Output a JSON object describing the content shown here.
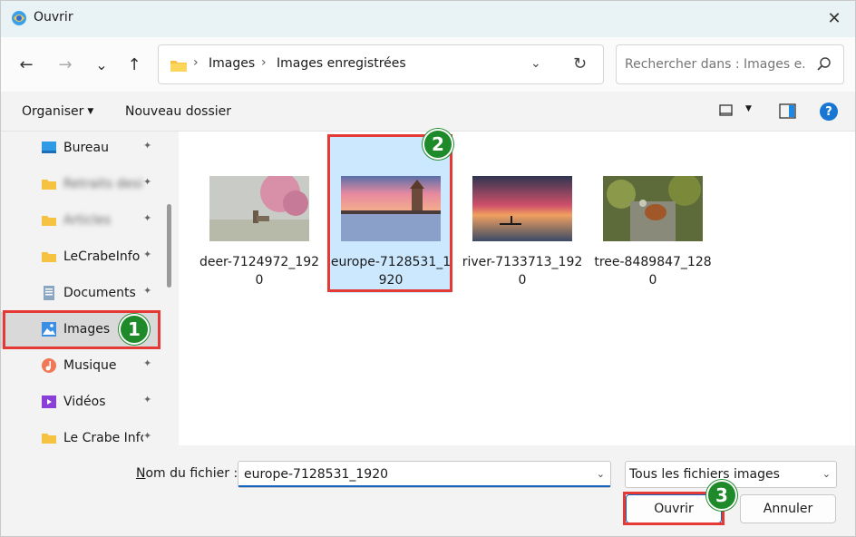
{
  "window": {
    "title": "Ouvrir",
    "close_glyph": "✕",
    "app_icon": "file-explorer-icon"
  },
  "nav": {
    "back_glyph": "←",
    "forward_glyph": "→",
    "recent_glyph": "⌄",
    "up_glyph": "↑",
    "breadcrumb": [
      "Images",
      "Images enregistrées"
    ],
    "separator": "›",
    "refresh_glyph": "↻",
    "dropdown_glyph": "⌄"
  },
  "search": {
    "placeholder": "Rechercher dans : Images e..."
  },
  "toolbar": {
    "organize_label": "Organiser",
    "new_folder_label": "Nouveau dossier",
    "caret": "▼",
    "help_label": "?"
  },
  "sidebar": {
    "items": [
      {
        "label": "Bureau",
        "icon": "desktop-icon",
        "pinned": true,
        "blurred": false
      },
      {
        "label": "Retraits design",
        "icon": "folder-icon",
        "pinned": true,
        "blurred": true
      },
      {
        "label": "Articles",
        "icon": "folder-icon",
        "pinned": true,
        "blurred": true
      },
      {
        "label": "LeCrabeInfo Images",
        "icon": "folder-icon",
        "pinned": true,
        "blurred": false
      },
      {
        "label": "Documents",
        "icon": "documents-icon",
        "pinned": true,
        "blurred": false
      },
      {
        "label": "Images",
        "icon": "pictures-icon",
        "pinned": true,
        "blurred": false,
        "selected": true
      },
      {
        "label": "Musique",
        "icon": "music-icon",
        "pinned": true,
        "blurred": false
      },
      {
        "label": "Vidéos",
        "icon": "videos-icon",
        "pinned": true,
        "blurred": false
      },
      {
        "label": "Le Crabe Info",
        "icon": "folder-icon",
        "pinned": true,
        "blurred": false
      }
    ],
    "pin_glyph": "📌"
  },
  "files": [
    {
      "name": "deer-7124972_1920",
      "kind": "deer"
    },
    {
      "name": "europe-7128531_1920",
      "kind": "europe",
      "selected": true
    },
    {
      "name": "river-7133713_1920",
      "kind": "river"
    },
    {
      "name": "tree-8489847_1280",
      "kind": "tree"
    }
  ],
  "footer": {
    "filename_label_prefix": "N",
    "filename_label_rest": "om du fichier :",
    "filename_value": "europe-7128531_1920",
    "filetype_value": "Tous les fichiers images",
    "open_label": "Ouvrir",
    "cancel_label": "Annuler",
    "dropdown_glyph": "⌄"
  },
  "annotations": {
    "step1": "1",
    "step2": "2",
    "step3": "3",
    "highlight_color": "#e53935",
    "badge_color": "#1e8a2a"
  }
}
